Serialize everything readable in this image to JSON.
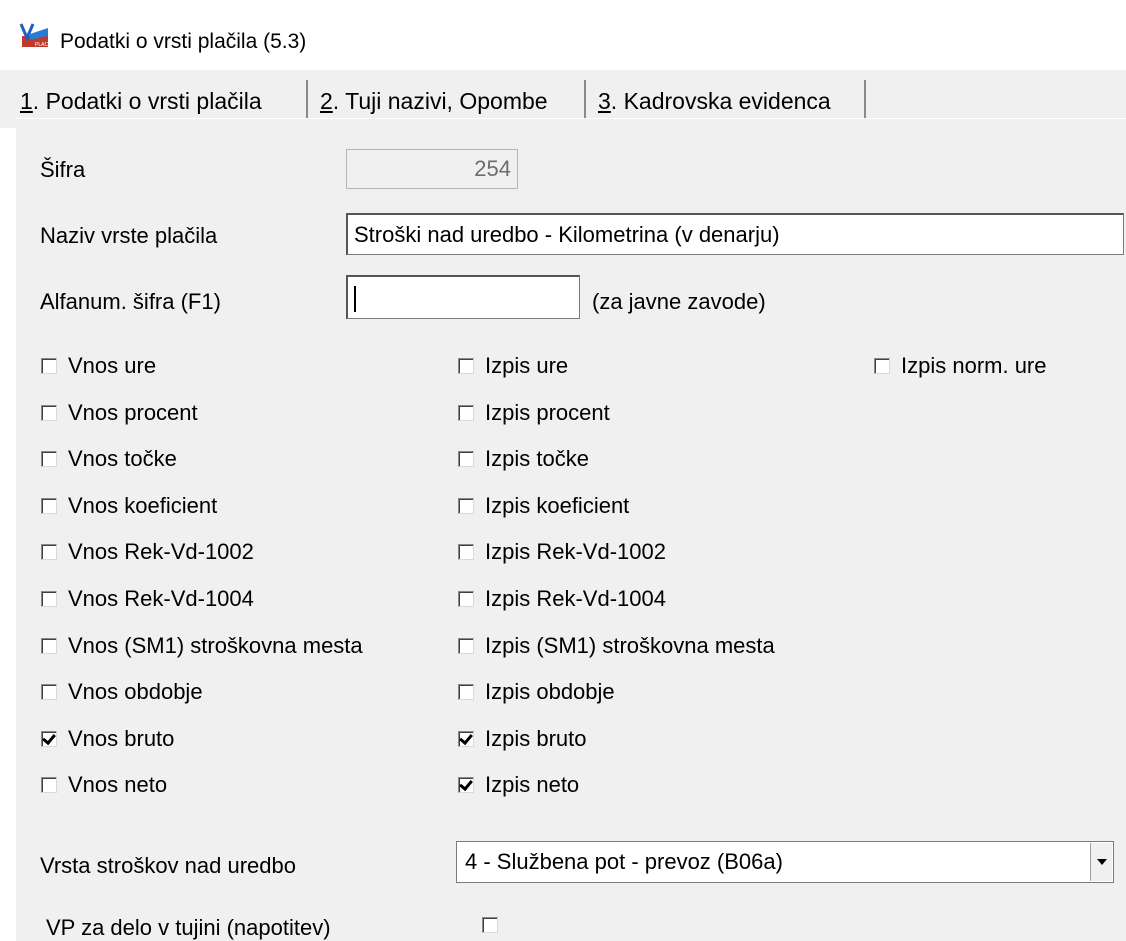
{
  "window": {
    "title": "Podatki o vrsti plačila  (5.3)",
    "icon": "vasco-place-app-icon"
  },
  "tabs": [
    {
      "num": "1",
      "label": ". Podatki o vrsti plačila",
      "active": true
    },
    {
      "num": "2",
      "label": ". Tuji nazivi, Opombe",
      "active": false
    },
    {
      "num": "3",
      "label": ". Kadrovska evidenca",
      "active": false
    }
  ],
  "form": {
    "sifra_label": "Šifra",
    "sifra_value": "254",
    "naziv_label": "Naziv vrste plačila",
    "naziv_value": "Stroški nad uredbo - Kilometrina (v denarju)",
    "alfa_label": "Alfanum. šifra (F1)",
    "alfa_value": "",
    "alfa_hint": "(za javne zavode)"
  },
  "checkboxes": {
    "col1": [
      {
        "label": "Vnos ure",
        "checked": false
      },
      {
        "label": "Vnos procent",
        "checked": false
      },
      {
        "label": "Vnos točke",
        "checked": false
      },
      {
        "label": "Vnos koeficient",
        "checked": false
      },
      {
        "label": "Vnos Rek-Vd-1002",
        "checked": false
      },
      {
        "label": "Vnos Rek-Vd-1004",
        "checked": false
      },
      {
        "label": "Vnos (SM1) stroškovna mesta",
        "checked": false
      },
      {
        "label": "Vnos obdobje",
        "checked": false
      },
      {
        "label": "Vnos bruto",
        "checked": true
      },
      {
        "label": "Vnos neto",
        "checked": false
      }
    ],
    "col2": [
      {
        "label": "Izpis ure",
        "checked": false
      },
      {
        "label": "Izpis procent",
        "checked": false
      },
      {
        "label": "Izpis točke",
        "checked": false
      },
      {
        "label": "Izpis koeficient",
        "checked": false
      },
      {
        "label": "Izpis Rek-Vd-1002",
        "checked": false
      },
      {
        "label": "Izpis Rek-Vd-1004",
        "checked": false
      },
      {
        "label": "Izpis (SM1) stroškovna mesta",
        "checked": false
      },
      {
        "label": "Izpis obdobje",
        "checked": false
      },
      {
        "label": "Izpis bruto",
        "checked": true
      },
      {
        "label": "Izpis neto",
        "checked": true
      }
    ],
    "col3": [
      {
        "label": "Izpis norm. ure",
        "checked": false
      }
    ]
  },
  "vrsta_stroskov": {
    "label": "Vrsta stroškov nad uredbo",
    "value": "4 - Službena pot - prevoz (B06a)"
  },
  "vp_tujina": {
    "label": "VP za delo v tujini (napotitev)",
    "checked": false
  }
}
